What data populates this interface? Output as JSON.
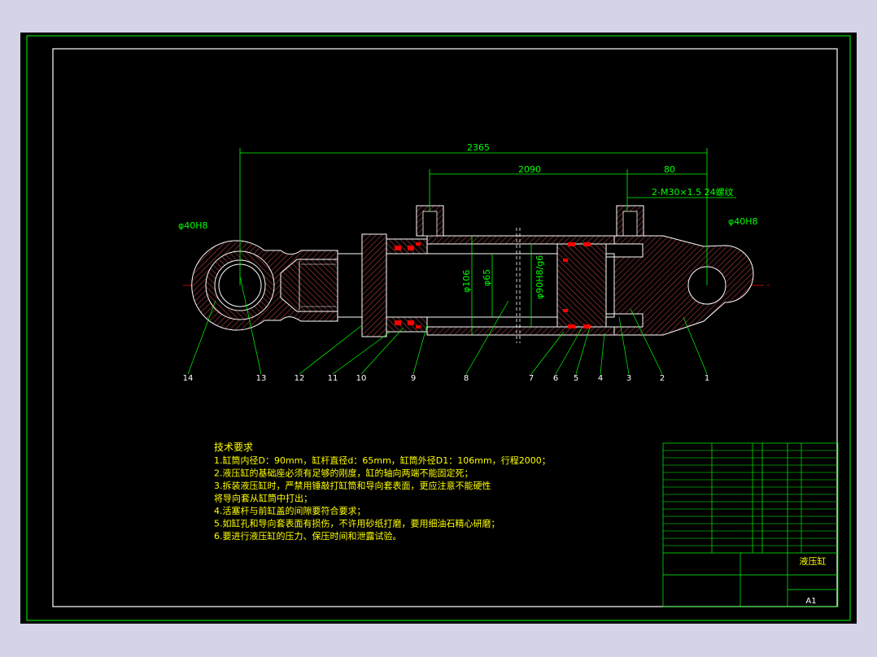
{
  "colors": {
    "outer_background": "#d4d4e6",
    "sheet": "#000000",
    "frame": "#00ff00",
    "outline": "#ffffff",
    "dimension": "#00ff00",
    "centerline": "#ff0000",
    "hatch": "#b04040",
    "seal": "#ff0000",
    "annotation_text": "#ffff00"
  },
  "dimensions": {
    "overall_length": "2365",
    "bore_to_port": "2090",
    "port_offset": "80",
    "port_thread": "2-M30×1.5 24螺纹",
    "pin_left": "φ40H8",
    "pin_right": "φ40H8",
    "tube_outer": "φ106",
    "rod_diameter": "φ65",
    "piston_fit": "φ90H8/g6"
  },
  "balloons": [
    "14",
    "13",
    "12",
    "11",
    "10",
    "9",
    "8",
    "7",
    "6",
    "5",
    "4",
    "3",
    "2",
    "1"
  ],
  "tech_title": "技术要求",
  "tech_requirements": [
    "1.缸筒内径D：90mm，缸杆直径d：65mm，缸筒外径D1：106mm，行程2000；",
    "2.液压缸的基础座必须有足够的刚度，缸的轴向两端不能固定死；",
    "3.拆装液压缸时，严禁用锤敲打缸筒和导向套表面，更应注意不能硬性",
    "  将导向套从缸筒中打出；",
    "4.活塞杆与前缸盖的间隙要符合要求；",
    "5.如缸孔和导向套表面有损伤，不许用砂纸打磨，要用细油石精心研磨；",
    "6.要进行液压缸的压力、保压时间和泄露试验。"
  ],
  "title_block": {
    "title": "液压缸",
    "sheet_size": "A1"
  }
}
